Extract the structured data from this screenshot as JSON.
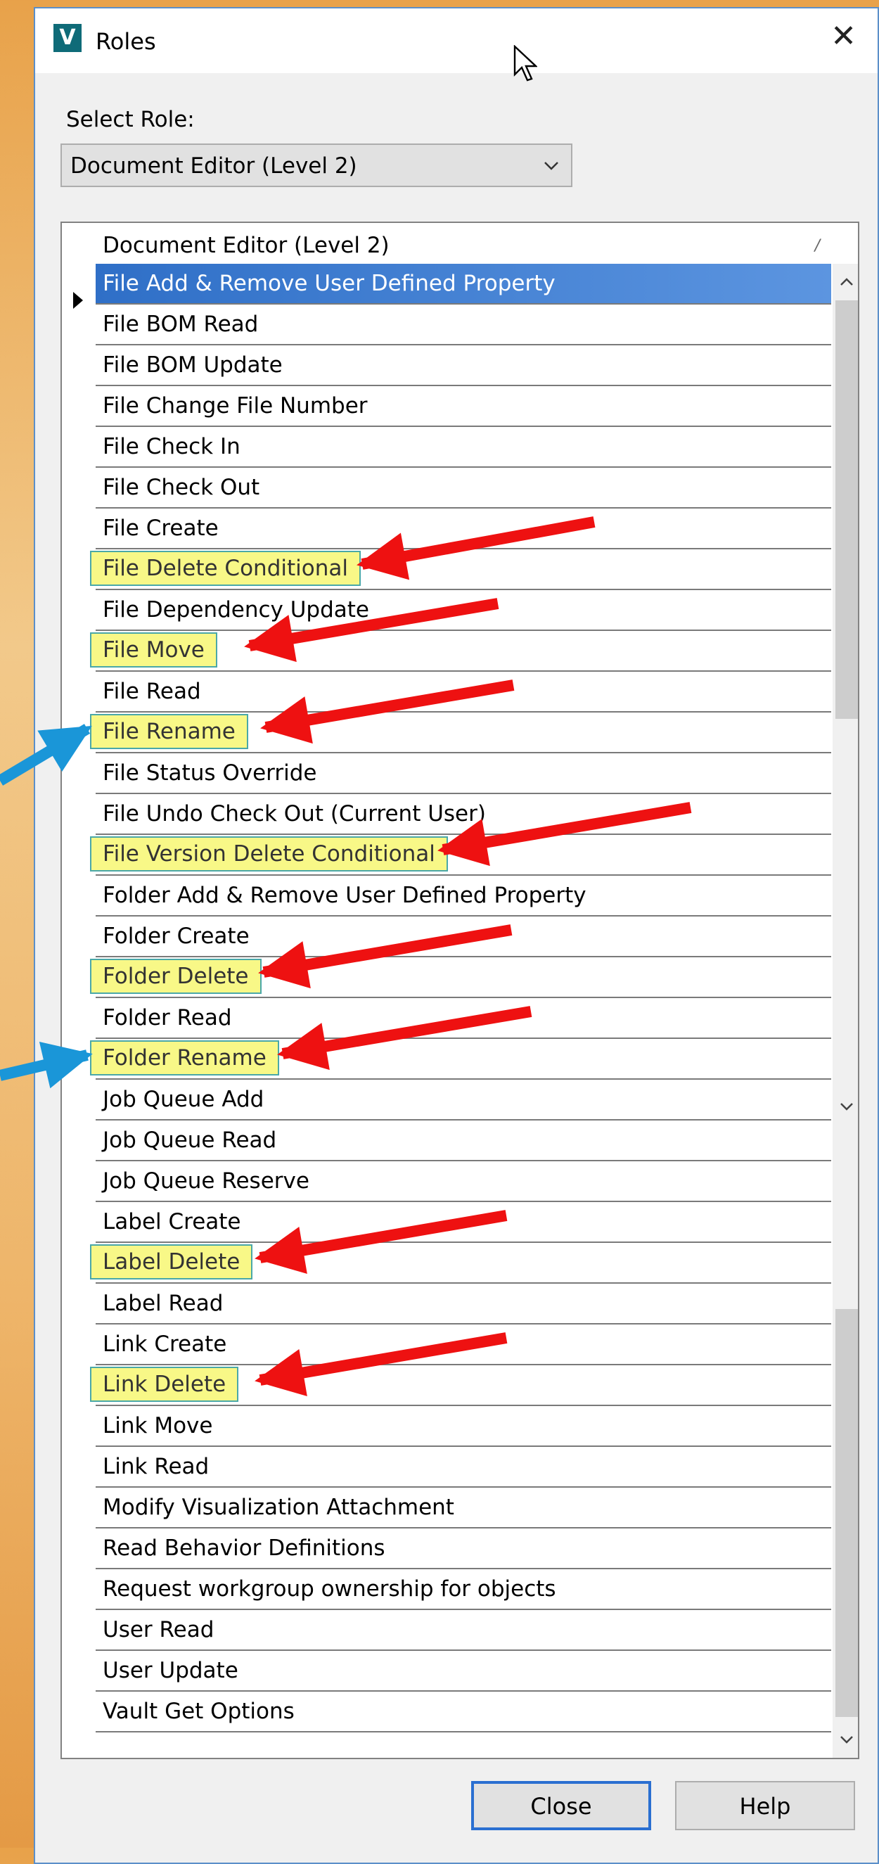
{
  "window": {
    "title": "Roles",
    "icon_label": "V",
    "close_glyph": "✕"
  },
  "select_role": {
    "label": "Select Role:",
    "value": "Document Editor (Level 2)"
  },
  "grid": {
    "column_header": "Document Editor (Level 2)",
    "sort_glyph": "/",
    "rows": [
      {
        "label": "File Add & Remove User Defined Property",
        "selected": true,
        "highlighted": false
      },
      {
        "label": "File BOM Read",
        "selected": false,
        "highlighted": false
      },
      {
        "label": "File BOM Update",
        "selected": false,
        "highlighted": false
      },
      {
        "label": "File Change File Number",
        "selected": false,
        "highlighted": false
      },
      {
        "label": "File Check In",
        "selected": false,
        "highlighted": false
      },
      {
        "label": "File Check Out",
        "selected": false,
        "highlighted": false
      },
      {
        "label": "File Create",
        "selected": false,
        "highlighted": false
      },
      {
        "label": "File Delete Conditional",
        "selected": false,
        "highlighted": true
      },
      {
        "label": "File Dependency Update",
        "selected": false,
        "highlighted": false
      },
      {
        "label": "File Move",
        "selected": false,
        "highlighted": true
      },
      {
        "label": "File Read",
        "selected": false,
        "highlighted": false
      },
      {
        "label": "File Rename",
        "selected": false,
        "highlighted": true
      },
      {
        "label": "File Status Override",
        "selected": false,
        "highlighted": false
      },
      {
        "label": "File Undo Check Out (Current User)",
        "selected": false,
        "highlighted": false
      },
      {
        "label": "File Version Delete Conditional",
        "selected": false,
        "highlighted": true
      },
      {
        "label": "Folder Add & Remove User Defined Property",
        "selected": false,
        "highlighted": false
      },
      {
        "label": "Folder Create",
        "selected": false,
        "highlighted": false
      },
      {
        "label": "Folder Delete",
        "selected": false,
        "highlighted": true
      },
      {
        "label": "Folder Read",
        "selected": false,
        "highlighted": false
      },
      {
        "label": "Folder Rename",
        "selected": false,
        "highlighted": true
      },
      {
        "label": "Job Queue Add",
        "selected": false,
        "highlighted": false
      },
      {
        "label": "Job Queue Read",
        "selected": false,
        "highlighted": false
      },
      {
        "label": "Job Queue Reserve",
        "selected": false,
        "highlighted": false
      },
      {
        "label": "Label Create",
        "selected": false,
        "highlighted": false
      },
      {
        "label": "Label Delete",
        "selected": false,
        "highlighted": true
      },
      {
        "label": "Label Read",
        "selected": false,
        "highlighted": false
      },
      {
        "label": "Link Create",
        "selected": false,
        "highlighted": false
      },
      {
        "label": "Link Delete",
        "selected": false,
        "highlighted": true
      },
      {
        "label": "Link Move",
        "selected": false,
        "highlighted": false
      },
      {
        "label": "Link Read",
        "selected": false,
        "highlighted": false
      },
      {
        "label": "Modify Visualization Attachment",
        "selected": false,
        "highlighted": false
      },
      {
        "label": "Read Behavior Definitions",
        "selected": false,
        "highlighted": false
      },
      {
        "label": "Request workgroup ownership for objects",
        "selected": false,
        "highlighted": false
      },
      {
        "label": "User Read",
        "selected": false,
        "highlighted": false
      },
      {
        "label": "User Update",
        "selected": false,
        "highlighted": false
      },
      {
        "label": "Vault Get Options",
        "selected": false,
        "highlighted": false
      }
    ]
  },
  "buttons": {
    "close": "Close",
    "help": "Help"
  },
  "colors": {
    "highlight": "#f8f887",
    "annotation_red": "#ee1111",
    "annotation_blue": "#1a96d8",
    "selection": "#2f6fc7"
  }
}
